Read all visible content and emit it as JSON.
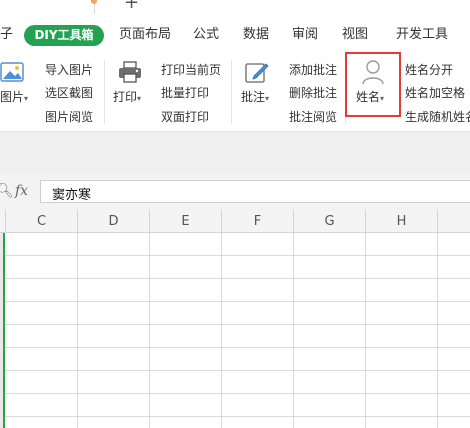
{
  "tabs": {
    "plus": "+"
  },
  "menu": {
    "partial_left": "子",
    "diy": "DIY工具箱",
    "items": [
      "页面布局",
      "公式",
      "数据",
      "审阅",
      "视图",
      "开发工具"
    ]
  },
  "ribbon": {
    "picture": {
      "label": "图片",
      "import": "导入图片",
      "select_screenshot": "选区截图",
      "browse": "图片阅览"
    },
    "print": {
      "label": "打印",
      "current_page": "打印当前页",
      "batch": "批量打印",
      "duplex": "双面打印"
    },
    "comment": {
      "label": "批注",
      "add": "添加批注",
      "delete": "删除批注",
      "browse": "批注阅览"
    },
    "name": {
      "label": "姓名",
      "split": "姓名分开",
      "add_space": "姓名加空格",
      "random": "生成随机姓名"
    }
  },
  "formula_bar": {
    "fx": "fx",
    "value": "窦亦寒"
  },
  "grid": {
    "columns": [
      "C",
      "D",
      "E",
      "F",
      "G",
      "H"
    ]
  }
}
